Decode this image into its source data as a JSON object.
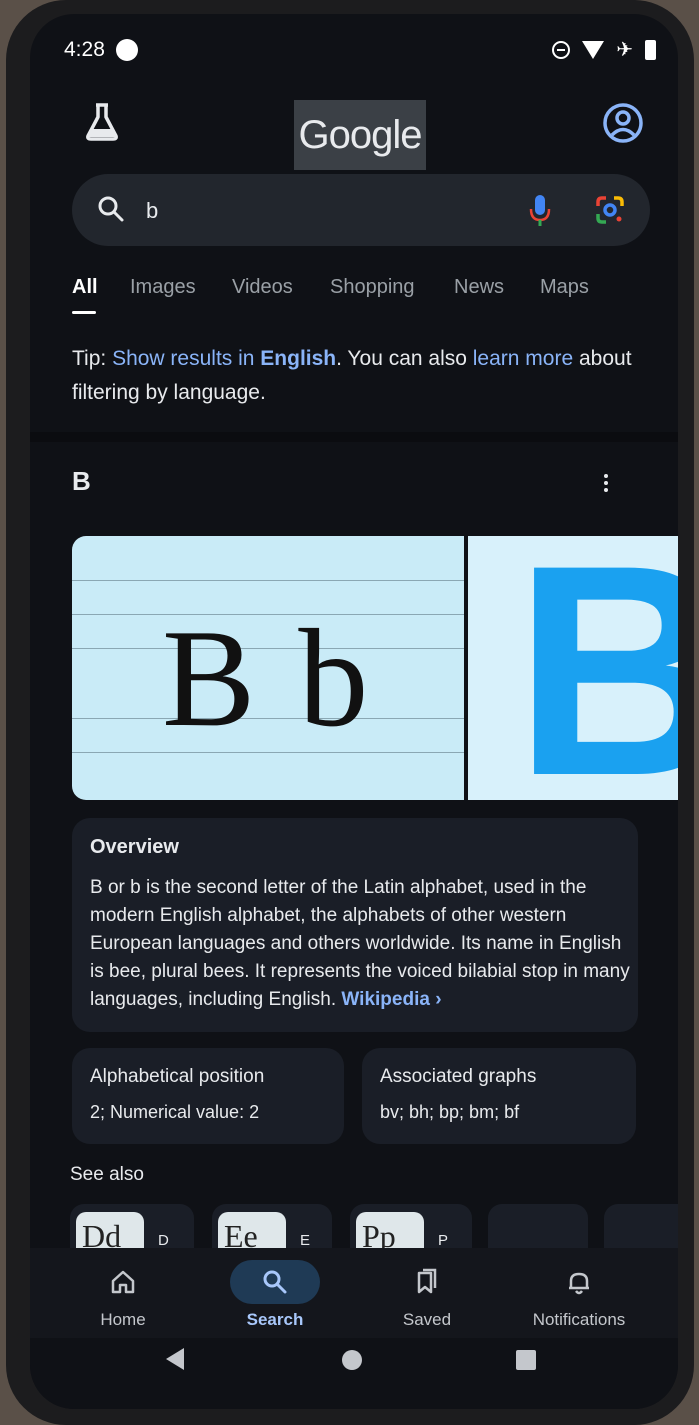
{
  "status_bar": {
    "time": "4:28"
  },
  "header": {
    "logo_text": "Google"
  },
  "search": {
    "query": "b",
    "placeholder": ""
  },
  "tabs": [
    {
      "label": "All",
      "active": true
    },
    {
      "label": "Images"
    },
    {
      "label": "Videos"
    },
    {
      "label": "Shopping"
    },
    {
      "label": "News"
    },
    {
      "label": "Maps"
    }
  ],
  "tip": {
    "prefix": "Tip: ",
    "show_results": "Show results in ",
    "language": "English",
    "middle": ". You can also ",
    "learn_more": "learn more",
    "suffix": " about filtering by language."
  },
  "knowledge_panel": {
    "title": "B",
    "image_letters": "B b",
    "image_big_letter": "B",
    "overview": {
      "title": "Overview",
      "text": "B or b is the second letter of the Latin alphabet, used in the modern English alphabet, the alphabets of other western European languages and others worldwide. Its name in English is bee, plural bees. It represents the voiced bilabial stop in many languages, including English. ",
      "source": "Wikipedia",
      "source_chevron": "›"
    },
    "facts": [
      {
        "title": "Alphabetical position",
        "value": "2; Numerical value: 2"
      },
      {
        "title": "Associated graphs",
        "value": "bv; bh; bp; bm; bf"
      }
    ],
    "see_also": {
      "title": "See also",
      "items": [
        {
          "thumb": "Dd",
          "label": "D"
        },
        {
          "thumb": "Ee",
          "label": "E"
        },
        {
          "thumb": "Pp",
          "label": "P"
        },
        {
          "thumb": "",
          "label": ""
        },
        {
          "thumb": "",
          "label": ""
        }
      ]
    }
  },
  "bottom_nav": [
    {
      "label": "Home",
      "icon": "home-icon"
    },
    {
      "label": "Search",
      "icon": "search-icon",
      "active": true
    },
    {
      "label": "Saved",
      "icon": "saved-icon"
    },
    {
      "label": "Notifications",
      "icon": "bell-icon"
    }
  ],
  "colors": {
    "link": "#8ab4f8",
    "background": "#0f1116",
    "card": "#1a1e27",
    "active_nav": "#a8c7fa"
  }
}
